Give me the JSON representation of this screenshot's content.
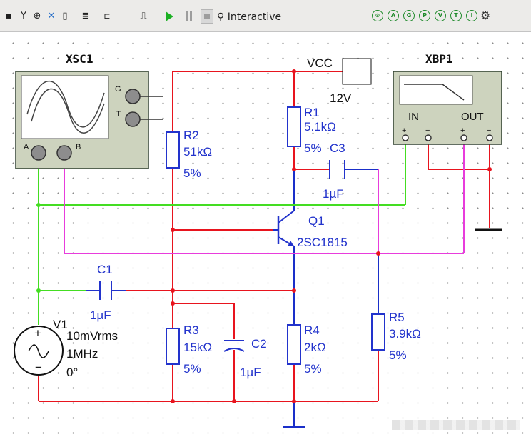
{
  "toolbar": {
    "mode_label": "Interactive",
    "left_icons": [
      "instrument-icon",
      "antenna-icon",
      "probe-icon",
      "run-icon",
      "bus-icon",
      "component-icon",
      "connector-icon",
      "pulse-icon"
    ],
    "right_icons": [
      "zoom-icon",
      "analysis-icon",
      "grapher-icon",
      "postprocessor-icon",
      "view-icon",
      "toggle-icon",
      "info-icon",
      "settings-icon"
    ]
  },
  "instruments": {
    "oscilloscope": {
      "name": "XSC1",
      "ports": {
        "g": "G",
        "t": "T",
        "a": "A",
        "b": "B"
      }
    },
    "bode_plotter": {
      "name": "XBP1",
      "in": "IN",
      "out": "OUT"
    }
  },
  "components": {
    "vcc": {
      "label": "VCC",
      "value": "12V"
    },
    "r1": {
      "name": "R1",
      "value": "5.1kΩ",
      "tol": "5%"
    },
    "r2": {
      "name": "R2",
      "value": "51kΩ",
      "tol": "5%"
    },
    "r3": {
      "name": "R3",
      "value": "15kΩ",
      "tol": "5%"
    },
    "r4": {
      "name": "R4",
      "value": "2kΩ",
      "tol": "5%"
    },
    "r5": {
      "name": "R5",
      "value": "3.9kΩ",
      "tol": "5%"
    },
    "c1": {
      "name": "C1",
      "value": "1µF"
    },
    "c2": {
      "name": "C2",
      "value": "1µF"
    },
    "c3": {
      "name": "C3",
      "value": "1µF"
    },
    "q1": {
      "name": "Q1",
      "part": "2SC1815"
    },
    "v1": {
      "name": "V1",
      "amp": "10mVrms",
      "freq": "1MHz",
      "phase": "0°"
    }
  },
  "colors": {
    "red_wire": "#e8141e",
    "green_wire": "#44dd22",
    "magenta_wire": "#e83cdc",
    "component": "#2233cc"
  }
}
